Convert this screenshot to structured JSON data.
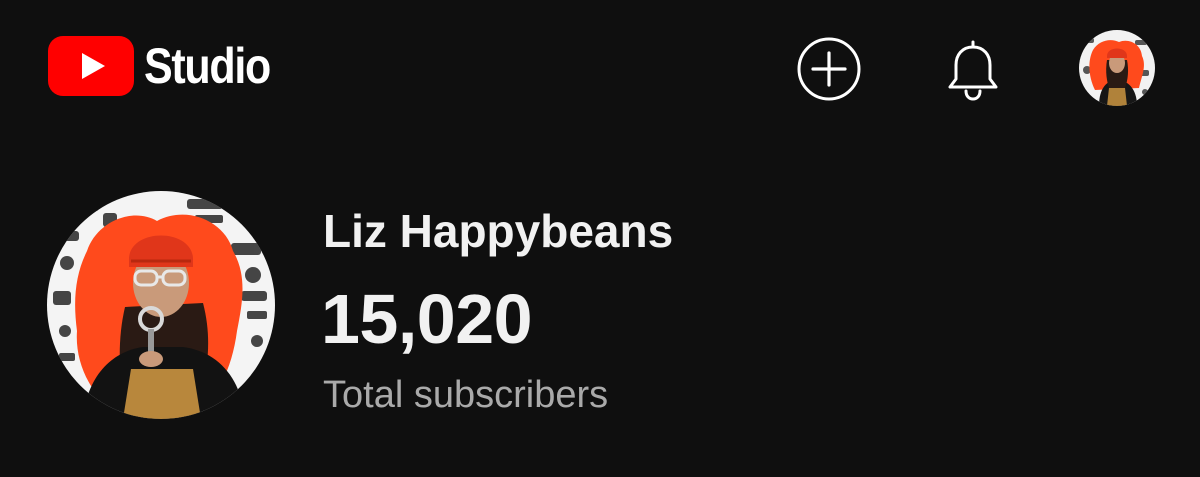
{
  "header": {
    "brand": "Studio",
    "brand_color": "#ff0000",
    "create_icon": "create-plus-icon",
    "notifications_icon": "bell-icon",
    "account_icon": "account-avatar"
  },
  "channel": {
    "name": "Liz Happybeans",
    "subscriber_count": "15,020",
    "subscriber_label": "Total subscribers"
  },
  "colors": {
    "background": "#0f0f0f",
    "text_primary": "#f1f1f1",
    "text_secondary": "#aaaaaa",
    "accent": "#ff0000"
  }
}
